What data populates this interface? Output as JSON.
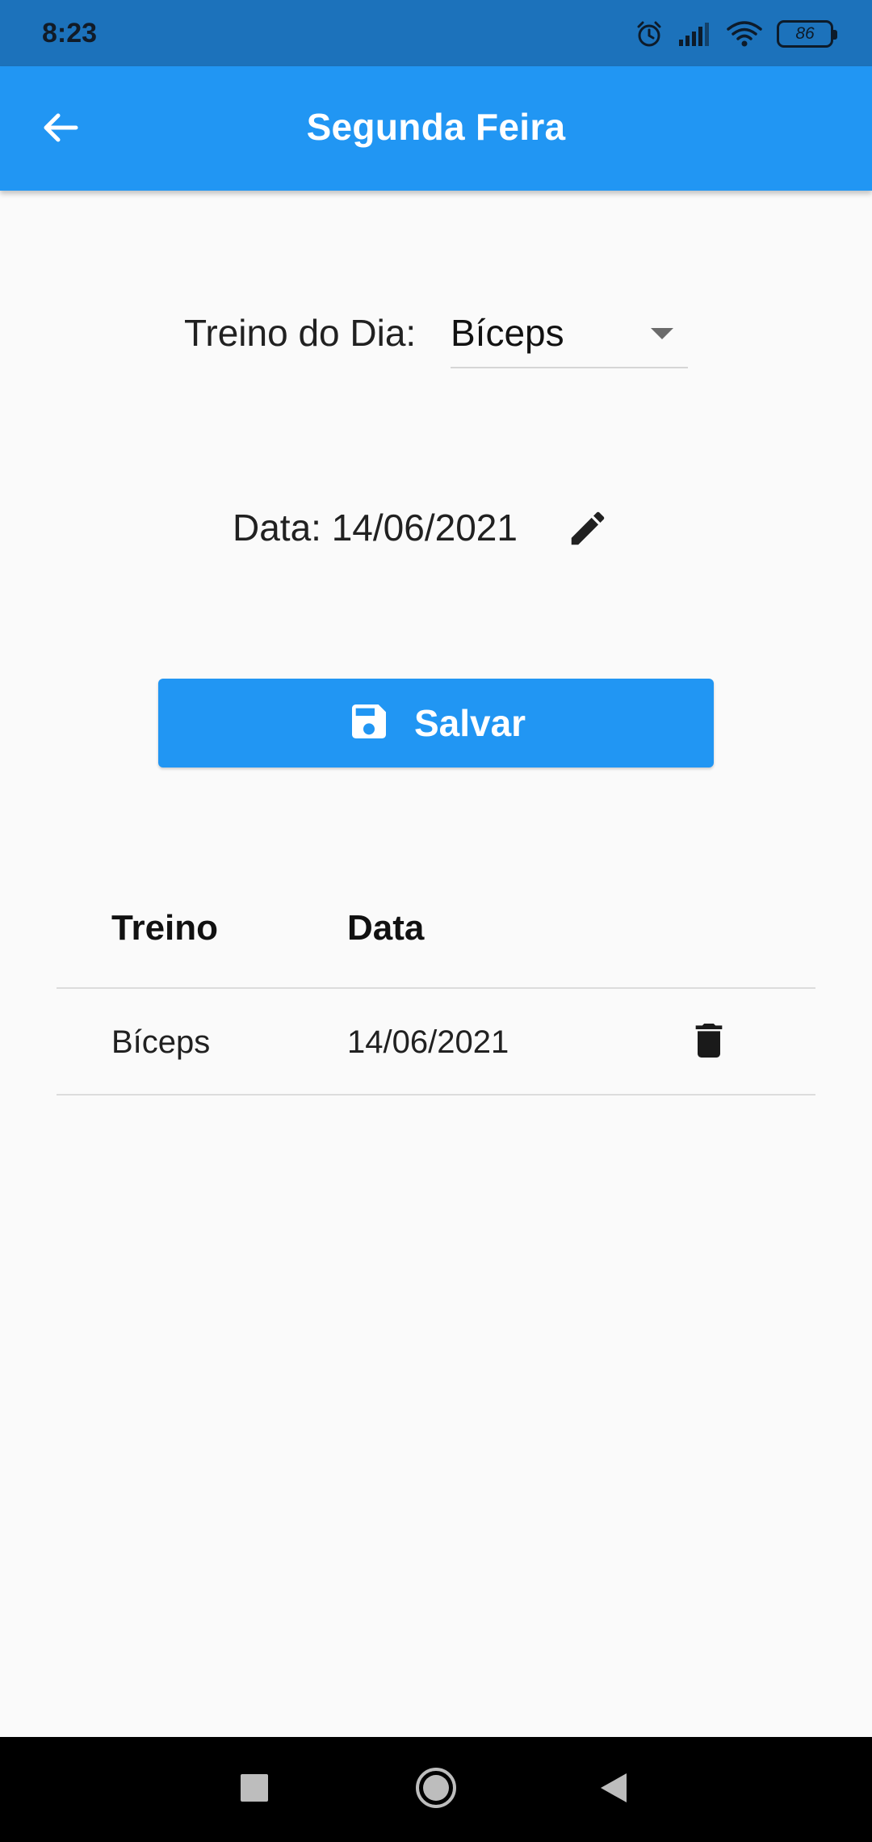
{
  "status_bar": {
    "time": "8:23",
    "battery": "86",
    "icons": [
      "alarm-icon",
      "signal-icon",
      "wifi-icon",
      "battery-icon"
    ]
  },
  "app_bar": {
    "title": "Segunda Feira",
    "back_icon": "arrow-back-icon",
    "background": "#2196f3"
  },
  "form": {
    "treino_label": "Treino do Dia:",
    "treino_selected": "Bíceps",
    "date_text": "Data: 14/06/2021",
    "edit_icon": "pencil-icon"
  },
  "save_button": {
    "label": "Salvar",
    "icon": "floppy-disk-icon"
  },
  "table": {
    "columns": [
      "Treino",
      "Data"
    ],
    "rows": [
      {
        "treino": "Bíceps",
        "data": "14/06/2021",
        "action_icon": "trash-icon"
      }
    ]
  },
  "nav_bar": {
    "buttons": [
      "recents-icon",
      "home-icon",
      "back-icon"
    ]
  },
  "colors": {
    "primary": "#2196f3",
    "status_bar": "#1c72bb",
    "background": "#fafafa"
  }
}
